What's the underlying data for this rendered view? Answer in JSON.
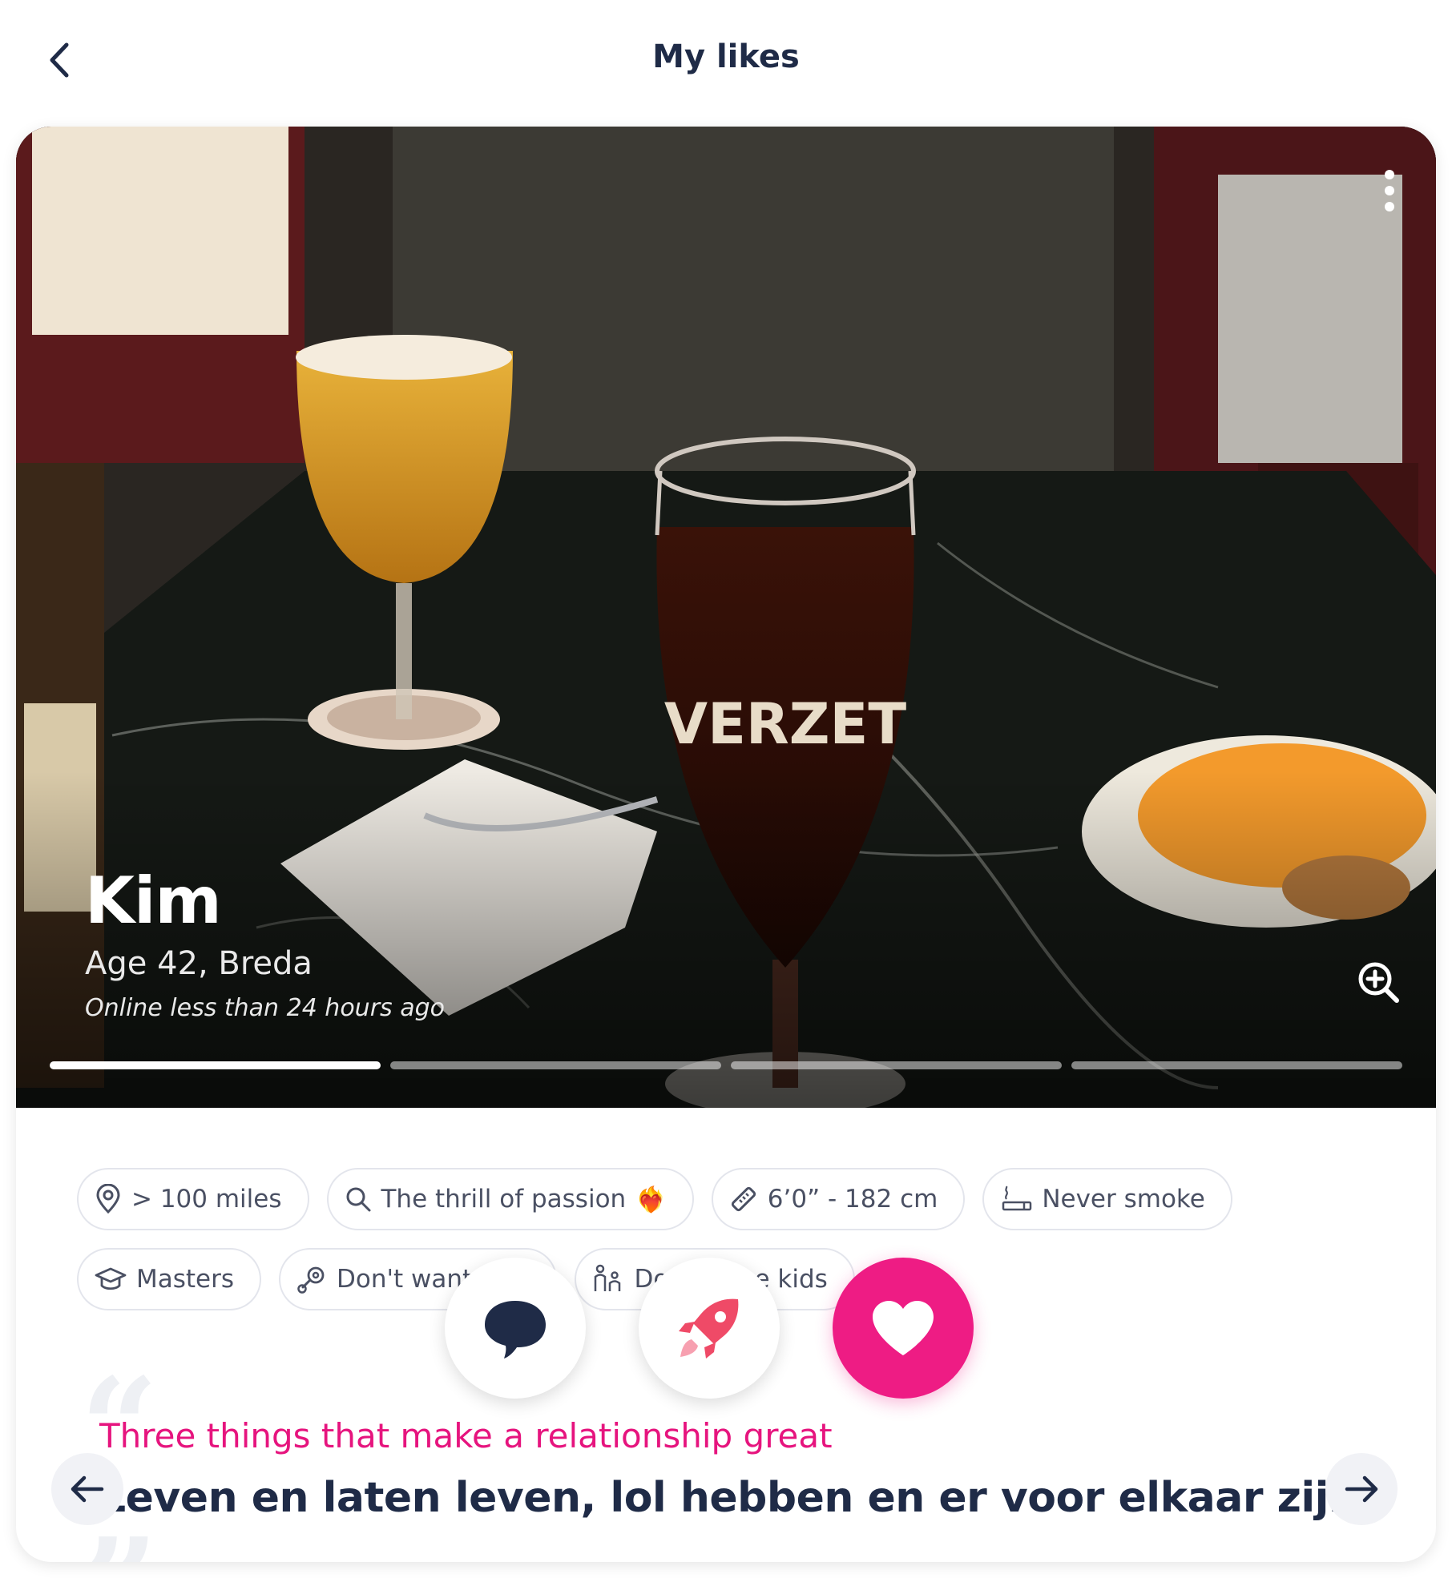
{
  "header": {
    "title": "My likes"
  },
  "profile": {
    "name": "Kim",
    "age_location": "Age 42, Breda",
    "online_status": "Online less than 24 hours ago",
    "photo_count": 4,
    "active_photo": 1
  },
  "chips": [
    {
      "icon": "location-pin-icon",
      "label": "> 100 miles"
    },
    {
      "icon": "search-icon",
      "label": "The thrill of passion",
      "emoji": "❤️‍🔥"
    },
    {
      "icon": "ruler-icon",
      "label": "6’0” - 182 cm"
    },
    {
      "icon": "smoking-icon",
      "label": "Never smoke"
    },
    {
      "icon": "graduation-cap-icon",
      "label": "Masters"
    },
    {
      "icon": "pacifier-icon",
      "label": "Don't want kids"
    },
    {
      "icon": "family-icon",
      "label": "Don't have kids"
    }
  ],
  "prompt": {
    "question": "Three things that make a relationship great",
    "answer": "Leven en laten leven, lol hebben en er voor elkaar zijn."
  },
  "colors": {
    "accent": "#ee1c84",
    "text_dark": "#1f2b47",
    "chip_border": "#e3e5ec"
  },
  "icons": {
    "back": "chevron-left-icon",
    "more": "more-vertical-icon",
    "zoom": "zoom-in-icon",
    "prev": "arrow-left-icon",
    "next": "arrow-right-icon",
    "chat": "chat-bubble-icon",
    "boost": "rocket-icon",
    "like": "heart-icon"
  }
}
